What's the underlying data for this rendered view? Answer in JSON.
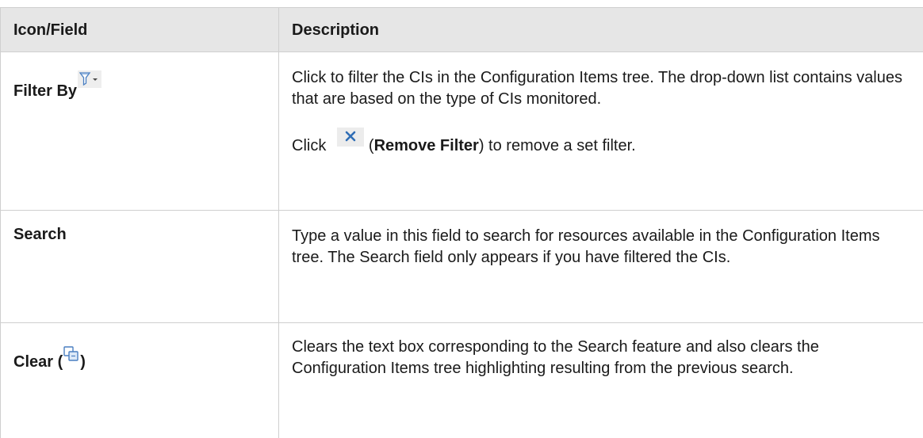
{
  "table": {
    "headers": {
      "field": "Icon/Field",
      "description": "Description"
    },
    "rows": {
      "filter_by": {
        "field": "Filter By",
        "description": "Click to filter the CIs in the Configuration Items tree. The drop-down list contains values that are based on the type of CIs monitored.",
        "note_prefix": "Click ",
        "note_open_paren": "(",
        "note_bold": "Remove Filter",
        "note_suffix": ") to remove a set filter."
      },
      "search": {
        "field": "Search",
        "description": "Type a value in this field to search for resources available in the Configuration Items tree. The Search field only appears if you have filtered the CIs."
      },
      "clear": {
        "field_prefix": "Clear (",
        "field_suffix": ")",
        "description": "Clears the text box corresponding to the Search feature and also clears the Configuration Items tree highlighting resulting from the previous search."
      }
    }
  },
  "colors": {
    "header_bg": "#e6e6e6",
    "border": "#cfcfcf",
    "icon_blue": "#4a7fc1"
  },
  "icons": {
    "filter": "filter-funnel-dropdown-icon",
    "remove_filter": "remove-filter-x-icon",
    "clear": "clear-highlight-icon"
  }
}
